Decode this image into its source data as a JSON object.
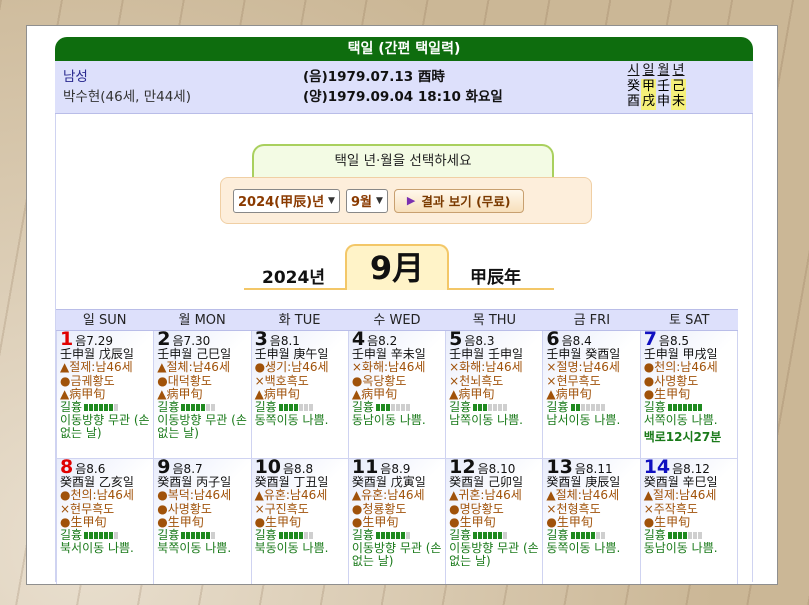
{
  "title": "택일 (간편 택일력)",
  "profile": {
    "gender": "남성",
    "name_age": "박수현(46세, 만44세)",
    "lunar_birth": "(음)1979.07.13 酉時",
    "solar_birth": "(양)1979.09.04 18:10 화요일"
  },
  "saju": {
    "headers": [
      "시",
      "일",
      "월",
      "년"
    ],
    "stems": [
      "癸",
      "甲",
      "壬",
      "己"
    ],
    "branches": [
      "酉",
      "戌",
      "申",
      "未"
    ]
  },
  "selector": {
    "prompt": "택일 년·월을 선택하세요",
    "year_value": "2024(甲辰)년",
    "month_value": "9월",
    "button_label": "결과 보기 (무료)"
  },
  "month_header": {
    "year": "2024년",
    "month": "9月",
    "ganzhi": "甲辰年"
  },
  "weekdays": [
    "일 SUN",
    "월 MON",
    "화 TUE",
    "수 WED",
    "목 THU",
    "금 FRI",
    "토 SAT"
  ],
  "weeks": [
    [
      {
        "day": "1",
        "lunar": "음7.29",
        "gz": "壬申월 戊辰일",
        "l1": "▲절제:남46세",
        "l2": "●금궤황도",
        "l3": "▲病甲旬",
        "kil": 6,
        "note": "이동방향 무관 (손 없는 날)"
      },
      {
        "day": "2",
        "lunar": "음7.30",
        "gz": "壬申월 己巳일",
        "l1": "▲절체:남46세",
        "l2": "●대덕황도",
        "l3": "▲病甲旬",
        "kil": 5,
        "note": "이동방향 무관 (손 없는 날)"
      },
      {
        "day": "3",
        "lunar": "음8.1",
        "gz": "壬申월 庚午일",
        "l1": "●생기:남46세",
        "l2": "×백호흑도",
        "l3": "▲病甲旬",
        "kil": 4,
        "note": "동쪽이동 나쁨."
      },
      {
        "day": "4",
        "lunar": "음8.2",
        "gz": "壬申월 辛未일",
        "l1": "×화해:남46세",
        "l2": "●옥당황도",
        "l3": "▲病甲旬",
        "kil": 3,
        "note": "동남이동 나쁨."
      },
      {
        "day": "5",
        "lunar": "음8.3",
        "gz": "壬申월 壬申일",
        "l1": "×화해:남46세",
        "l2": "×천뇌흑도",
        "l3": "▲病甲旬",
        "kil": 3,
        "note": "남쪽이동 나쁨."
      },
      {
        "day": "6",
        "lunar": "음8.4",
        "gz": "壬申월 癸酉일",
        "l1": "×절명:남46세",
        "l2": "×현무흑도",
        "l3": "▲病甲旬",
        "kil": 2,
        "note": "남서이동 나쁨."
      },
      {
        "day": "7",
        "lunar": "음8.5",
        "gz": "壬申월 甲戌일",
        "l1": "●천의:남46세",
        "l2": "●사명황도",
        "l3": "●生甲旬",
        "kil": 7,
        "note": "서쪽이동 나쁨.",
        "extra": "백로12시27분"
      }
    ],
    [
      {
        "day": "8",
        "lunar": "음8.6",
        "gz": "癸酉월 乙亥일",
        "l1": "●천의:남46세",
        "l2": "×현무흑도",
        "l3": "●生甲旬",
        "kil": 6,
        "note": "북서이동 나쁨."
      },
      {
        "day": "9",
        "lunar": "음8.7",
        "gz": "癸酉월 丙子일",
        "l1": "●복덕:남46세",
        "l2": "●사명황도",
        "l3": "●生甲旬",
        "kil": 6,
        "note": "북쪽이동 나쁨."
      },
      {
        "day": "10",
        "lunar": "음8.8",
        "gz": "癸酉월 丁丑일",
        "l1": "▲유혼:남46세",
        "l2": "×구진흑도",
        "l3": "●生甲旬",
        "kil": 5,
        "note": "북동이동 나쁨."
      },
      {
        "day": "11",
        "lunar": "음8.9",
        "gz": "癸酉월 戊寅일",
        "l1": "▲유혼:남46세",
        "l2": "●청룡황도",
        "l3": "●生甲旬",
        "kil": 6,
        "note": "이동방향 무관 (손 없는 날)"
      },
      {
        "day": "12",
        "lunar": "음8.10",
        "gz": "癸酉월 己卯일",
        "l1": "▲귀혼:남46세",
        "l2": "●명당황도",
        "l3": "●生甲旬",
        "kil": 6,
        "note": "이동방향 무관 (손 없는 날)"
      },
      {
        "day": "13",
        "lunar": "음8.11",
        "gz": "癸酉월 庚辰일",
        "l1": "▲절체:남46세",
        "l2": "×천형흑도",
        "l3": "●生甲旬",
        "kil": 5,
        "note": "동쪽이동 나쁨."
      },
      {
        "day": "14",
        "lunar": "음8.12",
        "gz": "癸酉월 辛巳일",
        "l1": "▲절제:남46세",
        "l2": "×주작흑도",
        "l3": "●生甲旬",
        "kil": 4,
        "note": "동남이동 나쁨."
      }
    ]
  ],
  "kil_label": "길흉",
  "colors": {
    "title_bar": "#0e6d0e",
    "info_bg": "#dde0fb",
    "sunday": "#e00000",
    "saturday": "#1010c0"
  }
}
